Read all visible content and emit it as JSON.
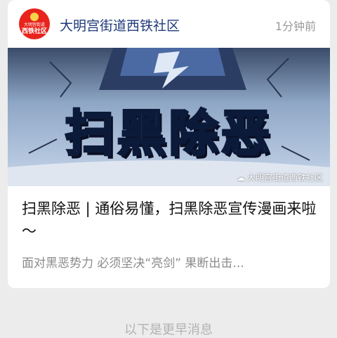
{
  "account": {
    "name": "大明宫街道西铁社区",
    "avatar_line1": "大明宫街道",
    "avatar_line2": "西铁社区"
  },
  "post": {
    "timestamp": "1分钟前",
    "cover_text": "扫黑除恶",
    "watermark": "大明宫街道西铁社区",
    "title": "扫黑除恶 | 通俗易懂，扫黑除恶宣传漫画来啦～",
    "summary": "面对黑恶势力   必须坚决“亮剑”   果断出击..."
  },
  "footer": {
    "divider_text": "以下是更早消息"
  }
}
